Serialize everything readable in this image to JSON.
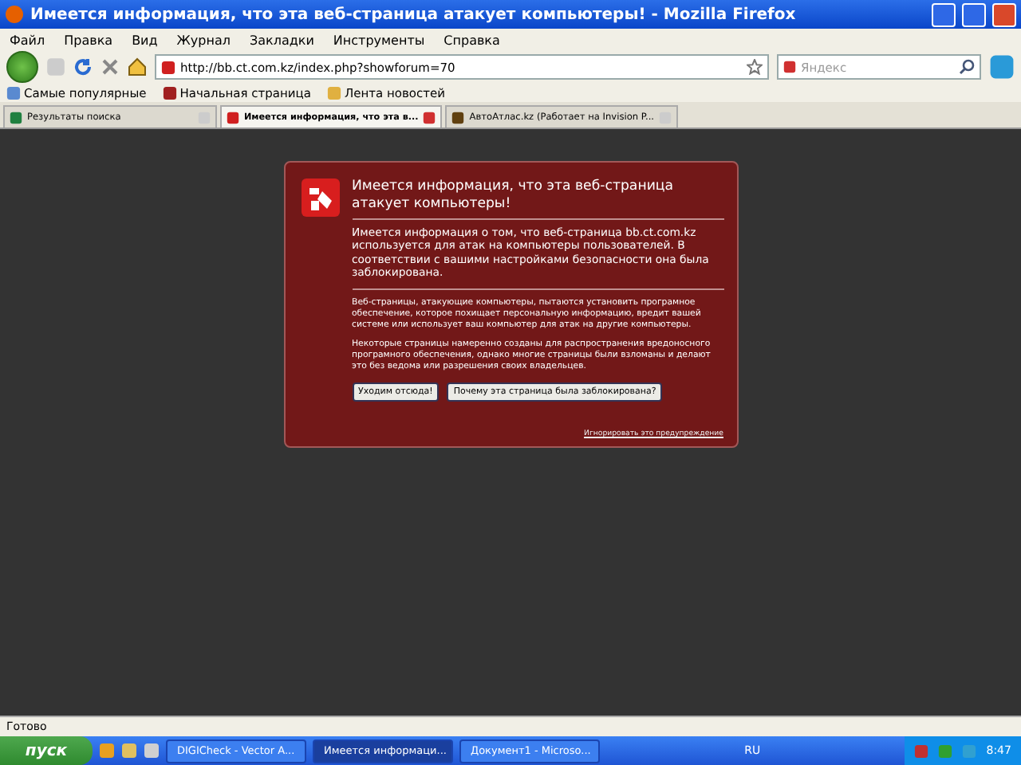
{
  "window": {
    "title": "Имеется информация, что эта веб-страница атакует компьютеры! - Mozilla Firefox"
  },
  "menu": [
    "Файл",
    "Правка",
    "Вид",
    "Журнал",
    "Закладки",
    "Инструменты",
    "Справка"
  ],
  "address": {
    "value": "http://bb.ct.com.kz/index.php?showforum=70"
  },
  "search": {
    "placeholder": "Яндекс"
  },
  "bookmarks": [
    "Самые популярные",
    "Начальная страница",
    "Лента новостей"
  ],
  "tabs": [
    {
      "label": "Результаты поиска",
      "selected": false
    },
    {
      "label": "Имеется информация, что эта в...",
      "selected": true
    },
    {
      "label": "АвтоАтлас.kz (Работает на Invision P...",
      "selected": false
    }
  ],
  "warning": {
    "title": "Имеется информация, что эта веб-страница атакует компьютеры!",
    "lead": "Имеется информация о том, что веб-страница bb.ct.com.kz используется для атак на компьютеры пользователей. В соответствии с вашими настройками безопасности она была заблокирована.",
    "paragraphs": [
      "Веб-страницы, атакующие компьютеры, пытаются установить програмное обеспечение, которое похищает персональную информацию, вредит вашей системе или использует ваш компьютер для атак на другие компьютеры.",
      "Некоторые страницы намеренно созданы для распространения вредоносного програмного обеспечения, однако многие страницы были взломаны и делают это без ведома или разрешения своих владельцев."
    ],
    "buttons": [
      "Уходим отсюда!",
      "Почему эта страница была заблокирована?"
    ],
    "ignore_link": "Игнорировать это предупреждение"
  },
  "status_bar": "Готово",
  "taskbar": {
    "start": "пуск",
    "tasks": [
      {
        "label": "DIGICheck - Vector A...",
        "selected": false
      },
      {
        "label": "Имеется информаци...",
        "selected": true
      },
      {
        "label": "Документ1 - Microso...",
        "selected": false
      }
    ],
    "language": "RU",
    "clock": "8:47"
  }
}
